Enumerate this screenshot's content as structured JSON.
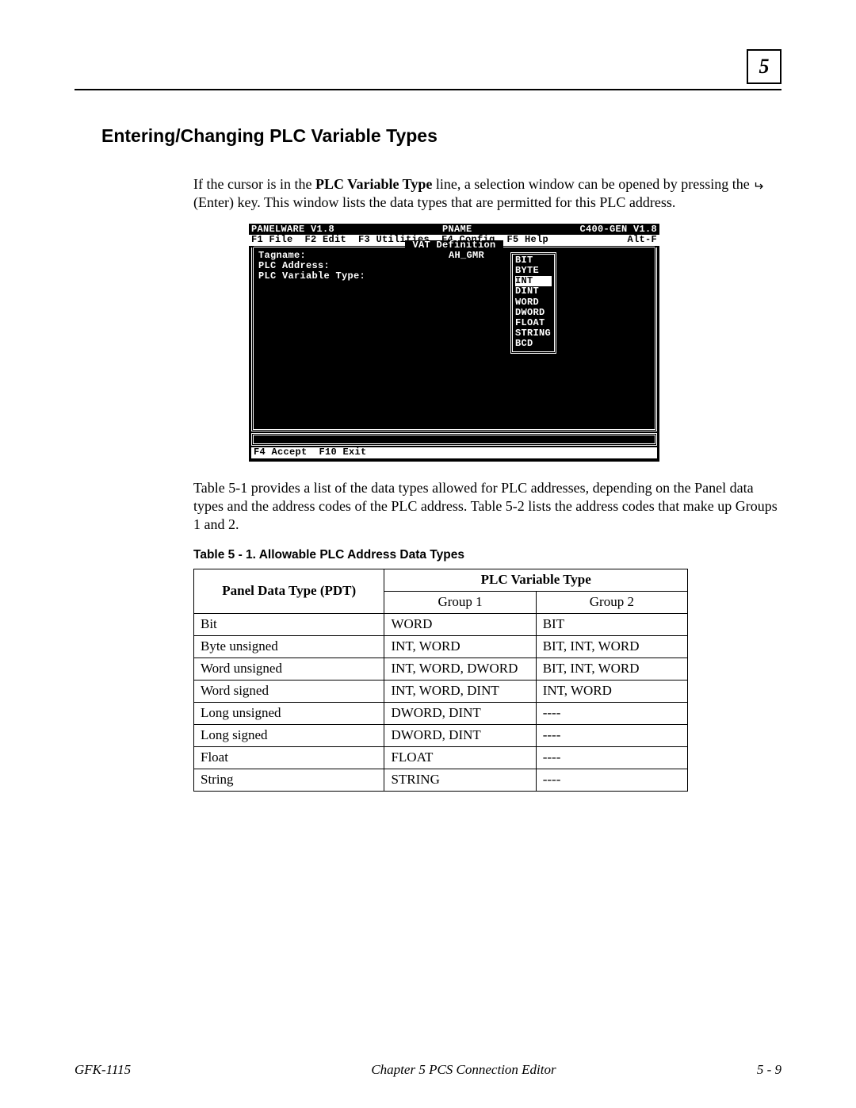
{
  "chapter_number": "5",
  "section_title": "Entering/Changing PLC Variable Types",
  "para1_a": "If the cursor is in the ",
  "para1_bold": "PLC Variable Type",
  "para1_b": " line, a selection window can be opened by pressing the ",
  "para1_c": " (Enter) key. This window lists the data types that are permitted for this PLC address.",
  "dos": {
    "top_left": "PANELWARE V1.8",
    "top_center": "PNAME",
    "top_right": "C400-GEN V1.8",
    "menubar_left": "F1 File  F2 Edit  F3 Utilities  F4 Config  F5 Help",
    "menubar_right": "Alt-F",
    "panel_title": " VAT Definition ",
    "lines": [
      "Tagname:                        AH_GMR",
      "PLC Address:",
      "PLC Variable Type:"
    ],
    "popup_items": [
      "BIT",
      "BYTE",
      "INT",
      "DINT",
      "WORD",
      "DWORD",
      "FLOAT",
      "STRING",
      "BCD"
    ],
    "popup_selected_index": 2,
    "bottom_hint": "F4 Accept  F10 Exit"
  },
  "para2": "Table 5-1 provides a list of the data types allowed for PLC addresses, depending on the Panel data types and the address codes of the PLC address. Table 5-2 lists the address codes that make up Groups 1 and 2.",
  "table_caption": "Table 5 - 1.  Allowable PLC Address Data Types",
  "table": {
    "header_span": "PLC Variable Type",
    "header_pdt": "Panel Data Type (PDT)",
    "header_g1": "Group 1",
    "header_g2": "Group 2",
    "rows": [
      {
        "pdt": "Bit",
        "g1": "WORD",
        "g2": "BIT"
      },
      {
        "pdt": "Byte unsigned",
        "g1": "INT, WORD",
        "g2": "BIT, INT, WORD"
      },
      {
        "pdt": "Word unsigned",
        "g1": "INT, WORD, DWORD",
        "g2": "BIT, INT, WORD"
      },
      {
        "pdt": "Word signed",
        "g1": "INT, WORD, DINT",
        "g2": "INT, WORD"
      },
      {
        "pdt": "Long unsigned",
        "g1": "DWORD, DINT",
        "g2": "----"
      },
      {
        "pdt": "Long signed",
        "g1": "DWORD, DINT",
        "g2": "----"
      },
      {
        "pdt": "Float",
        "g1": "FLOAT",
        "g2": "----"
      },
      {
        "pdt": "String",
        "g1": "STRING",
        "g2": "----"
      }
    ]
  },
  "footer": {
    "left": "GFK-1115",
    "center": "Chapter 5    PCS Connection Editor",
    "right": "5 - 9"
  }
}
